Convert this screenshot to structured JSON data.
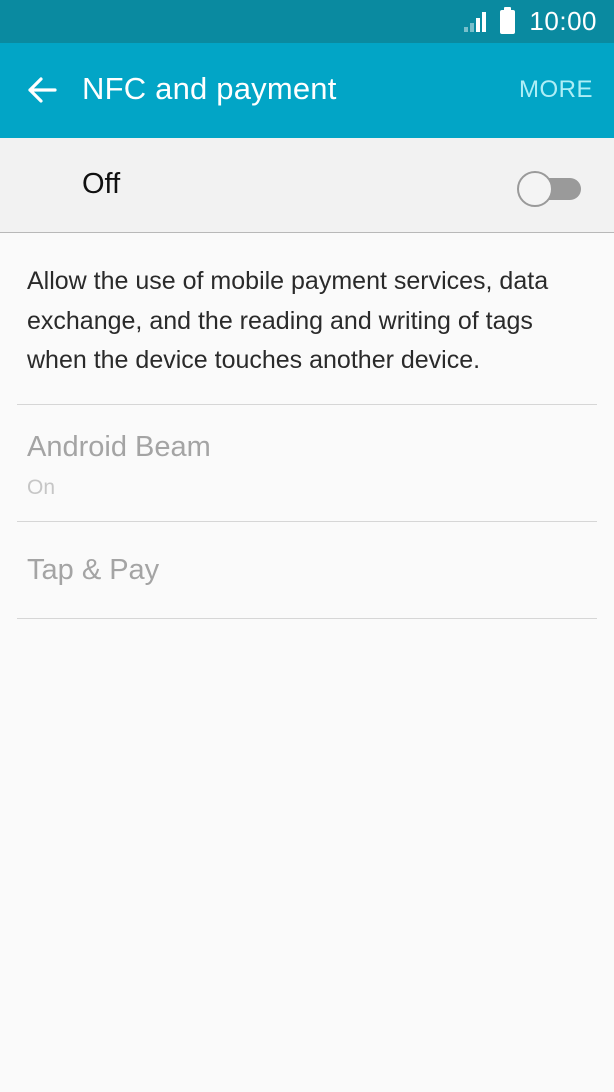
{
  "status_bar": {
    "time": "10:00",
    "icons": [
      "signal-icon",
      "battery-icon"
    ]
  },
  "app_bar": {
    "title": "NFC and payment",
    "back_icon": "arrow-left-icon",
    "more_label": "MORE",
    "background": "#02a5c6"
  },
  "master_switch": {
    "label": "Off",
    "state": "off"
  },
  "description": "Allow the use of mobile payment services, data exchange, and the reading and writing of tags when the device touches another device.",
  "settings": [
    {
      "title": "Android Beam",
      "summary": "On",
      "enabled": false
    },
    {
      "title": "Tap & Pay",
      "enabled": false
    }
  ]
}
